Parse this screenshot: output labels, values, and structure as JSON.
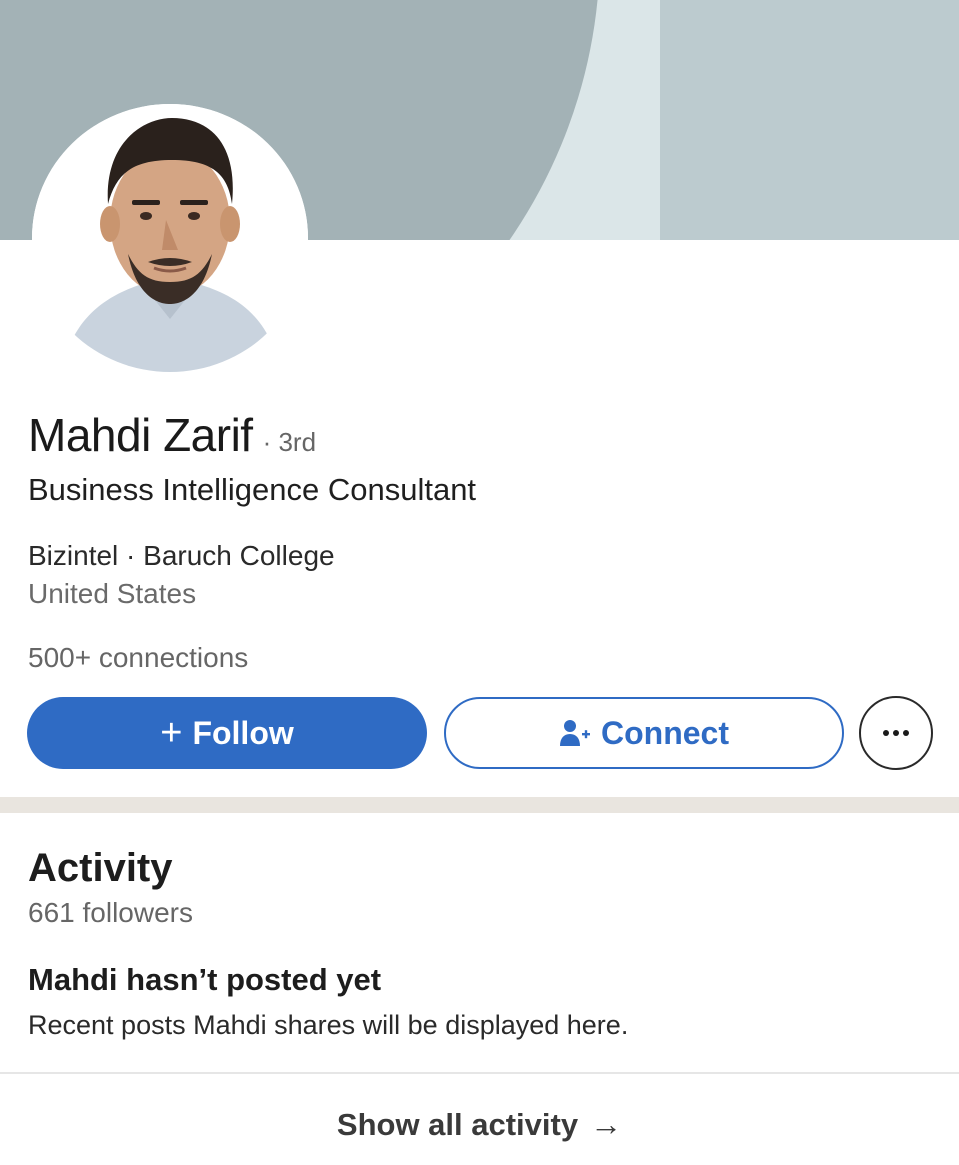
{
  "profile": {
    "name": "Mahdi Zarif",
    "degree": "· 3rd",
    "headline": "Business Intelligence Consultant",
    "org_line": "Bizintel · Baruch College",
    "location": "United States",
    "connections": "500+ connections"
  },
  "actions": {
    "follow_plus": "+",
    "follow_label": "Follow",
    "connect_label": "Connect",
    "more_icon": "ellipsis-icon"
  },
  "activity": {
    "title": "Activity",
    "followers": "661 followers",
    "empty_title": "Mahdi hasn’t posted yet",
    "empty_desc": "Recent posts Mahdi shares will be displayed here.",
    "show_all_label": "Show all activity",
    "show_all_arrow": "→"
  },
  "colors": {
    "primary_blue": "#2f6bc4",
    "cover_light": "#dbe6e8",
    "cover_mid": "#bccbcf",
    "cover_dark": "#a3b2b6",
    "section_divider": "#e9e5df"
  }
}
